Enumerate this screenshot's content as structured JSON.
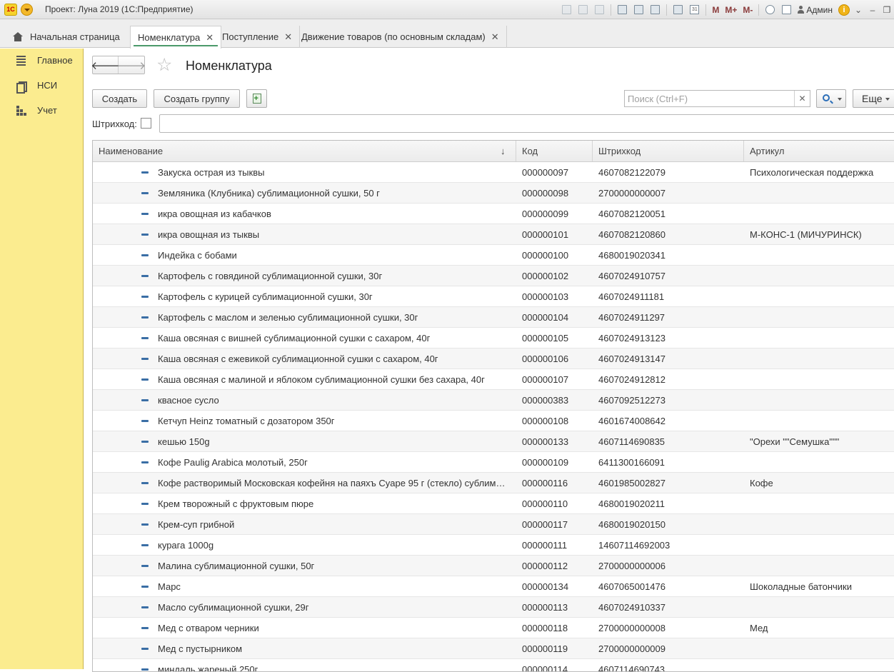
{
  "window": {
    "title": "Проект: Луна 2019  (1С:Предприятие)",
    "logo_text": "1С"
  },
  "toolbar_right": {
    "m": "M",
    "m_plus": "M+",
    "m_minus": "M-",
    "user": "Админ",
    "info": "i"
  },
  "tabs": [
    {
      "label": "Начальная страница",
      "closable": false,
      "active": false
    },
    {
      "label": "Номенклатура",
      "closable": true,
      "active": true
    },
    {
      "label": "Поступление",
      "closable": true,
      "active": false
    },
    {
      "label": "Движение товаров (по основным складам)",
      "closable": true,
      "active": false
    }
  ],
  "sidebar": {
    "items": [
      {
        "label": "Главное",
        "icon": "menu-lines-icon"
      },
      {
        "label": "НСИ",
        "icon": "books-icon"
      },
      {
        "label": "Учет",
        "icon": "grid-icon"
      }
    ]
  },
  "page": {
    "title": "Номенклатура",
    "create_label": "Создать",
    "create_group_label": "Создать группу",
    "search_placeholder": "Поиск (Ctrl+F)",
    "more_label": "Еще",
    "barcode_label": "Штрихкод:"
  },
  "table": {
    "columns": [
      "Наименование",
      "Код",
      "Штрихкод",
      "Артикул"
    ],
    "rows": [
      {
        "name": "Закуска острая из тыквы",
        "code": "000000097",
        "barcode": "4607082122079",
        "article": "Психологическая поддержка"
      },
      {
        "name": "Земляника (Клубника) сублимационной сушки, 50 г",
        "code": "000000098",
        "barcode": "2700000000007",
        "article": ""
      },
      {
        "name": "икра овощная из кабачков",
        "code": "000000099",
        "barcode": "4607082120051",
        "article": ""
      },
      {
        "name": "икра овощная из тыквы",
        "code": "000000101",
        "barcode": "4607082120860",
        "article": "М-КОНС-1 (МИЧУРИНСК)"
      },
      {
        "name": "Индейка с бобами",
        "code": "000000100",
        "barcode": "4680019020341",
        "article": ""
      },
      {
        "name": "Картофель с говядиной сублимационной сушки, 30г",
        "code": "000000102",
        "barcode": "4607024910757",
        "article": ""
      },
      {
        "name": "Картофель с курицей сублимационной сушки, 30г",
        "code": "000000103",
        "barcode": "4607024911181",
        "article": ""
      },
      {
        "name": "Картофель с маслом и зеленью сублимационной сушки, 30г",
        "code": "000000104",
        "barcode": "4607024911297",
        "article": ""
      },
      {
        "name": "Каша овсяная с вишней сублимационной сушки с сахаром, 40г",
        "code": "000000105",
        "barcode": "4607024913123",
        "article": ""
      },
      {
        "name": "Каша овсяная с ежевикой сублимационной сушки с сахаром, 40г",
        "code": "000000106",
        "barcode": "4607024913147",
        "article": ""
      },
      {
        "name": "Каша овсяная с малиной и яблоком сублимационной сушки без сахара, 40г",
        "code": "000000107",
        "barcode": "4607024912812",
        "article": ""
      },
      {
        "name": "квасное сусло",
        "code": "000000383",
        "barcode": "4607092512273",
        "article": ""
      },
      {
        "name": "Кетчуп Heinz томатный с дозатором 350г",
        "code": "000000108",
        "barcode": "4601674008642",
        "article": ""
      },
      {
        "name": "кешью 150g",
        "code": "000000133",
        "barcode": "4607114690835",
        "article": "\"Орехи \"\"Семушка\"\"\""
      },
      {
        "name": "Кофе Paulig Arabica молотый, 250г",
        "code": "000000109",
        "barcode": "6411300166091",
        "article": ""
      },
      {
        "name": "Кофе растворимый Московская кофейня на паяхъ Cyape 95 г (стекло) сублими...",
        "code": "000000116",
        "barcode": "4601985002827",
        "article": "Кофе"
      },
      {
        "name": "Крем творожный с фруктовым пюре",
        "code": "000000110",
        "barcode": "4680019020211",
        "article": ""
      },
      {
        "name": "Крем-суп грибной",
        "code": "000000117",
        "barcode": "4680019020150",
        "article": ""
      },
      {
        "name": "курага 1000g",
        "code": "000000111",
        "barcode": "14607114692003",
        "article": ""
      },
      {
        "name": "Малина сублимационной сушки, 50г",
        "code": "000000112",
        "barcode": "2700000000006",
        "article": ""
      },
      {
        "name": "Марс",
        "code": "000000134",
        "barcode": "4607065001476",
        "article": "Шоколадные батончики"
      },
      {
        "name": "Масло сублимационной сушки, 29г",
        "code": "000000113",
        "barcode": "4607024910337",
        "article": ""
      },
      {
        "name": "Мед с отваром черники",
        "code": "000000118",
        "barcode": "2700000000008",
        "article": "Мед"
      },
      {
        "name": "Мед с пустырником",
        "code": "000000119",
        "barcode": "2700000000009",
        "article": ""
      },
      {
        "name": "миндаль жареный 250г",
        "code": "000000114",
        "barcode": "4607114690743",
        "article": ""
      }
    ]
  }
}
